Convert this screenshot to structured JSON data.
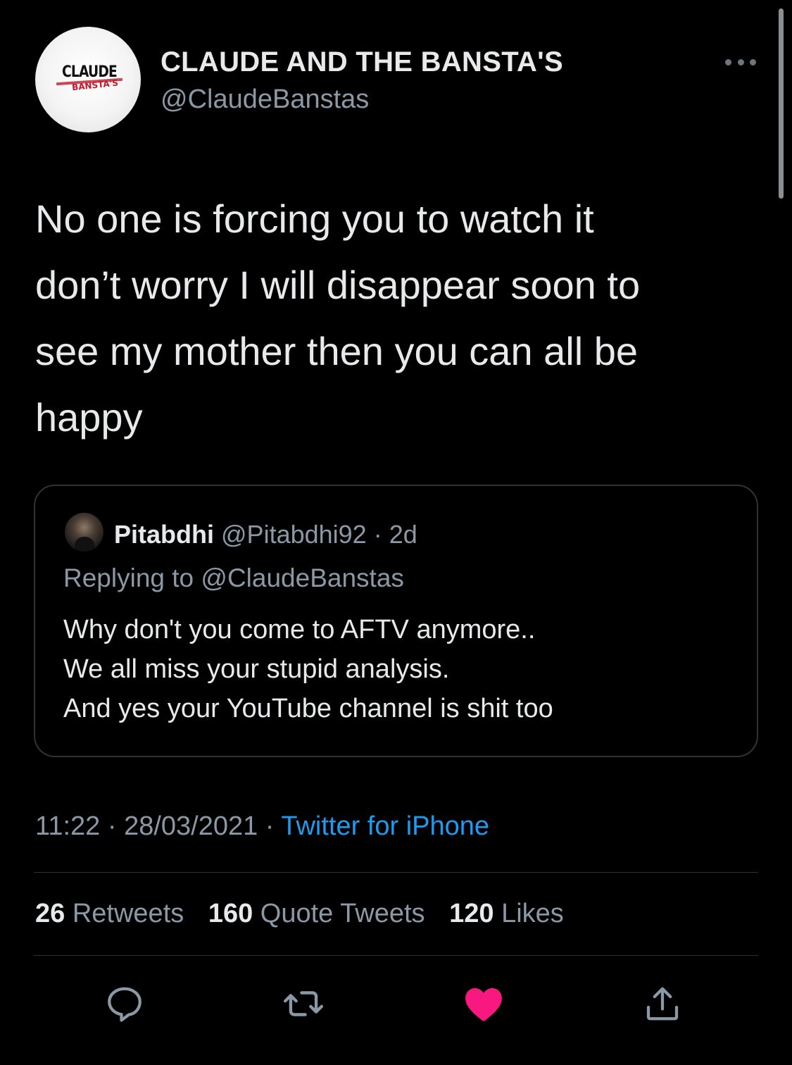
{
  "author": {
    "display_name": "CLAUDE AND THE BANSTA'S",
    "handle": "@ClaudeBanstas",
    "avatar_logo_top": "CLAUDE",
    "avatar_logo_bottom": "BANSTA'S"
  },
  "tweet": {
    "text_lines": [
      "No one is forcing you to watch it",
      "don’t worry I will disappear soon to",
      "see my mother then you can all be",
      "happy"
    ]
  },
  "quoted": {
    "name": "Pitabdhi",
    "handle": "@Pitabdhi92",
    "separator": " · ",
    "age": "2d",
    "replying_prefix": "Replying to ",
    "replying_handle": "@ClaudeBanstas",
    "body_lines": [
      "Why don't you come to AFTV anymore..",
      "We all miss your stupid analysis.",
      "And yes your YouTube channel is shit too"
    ]
  },
  "meta": {
    "time": "11:22",
    "date": "28/03/2021",
    "separator": " · ",
    "source": "Twitter for iPhone"
  },
  "stats": {
    "retweets_count": "26",
    "retweets_label": "Retweets",
    "quotes_count": "160",
    "quotes_label": "Quote Tweets",
    "likes_count": "120",
    "likes_label": "Likes"
  },
  "icons": {
    "reply": "reply-icon",
    "retweet": "retweet-icon",
    "like": "heart-icon",
    "share": "share-icon",
    "more": "more-icon"
  },
  "colors": {
    "background": "#000000",
    "text_primary": "#e7e9ea",
    "text_secondary": "#8b98a5",
    "link": "#1d9bf0",
    "like_active": "#f91880",
    "border": "#2f3336"
  }
}
